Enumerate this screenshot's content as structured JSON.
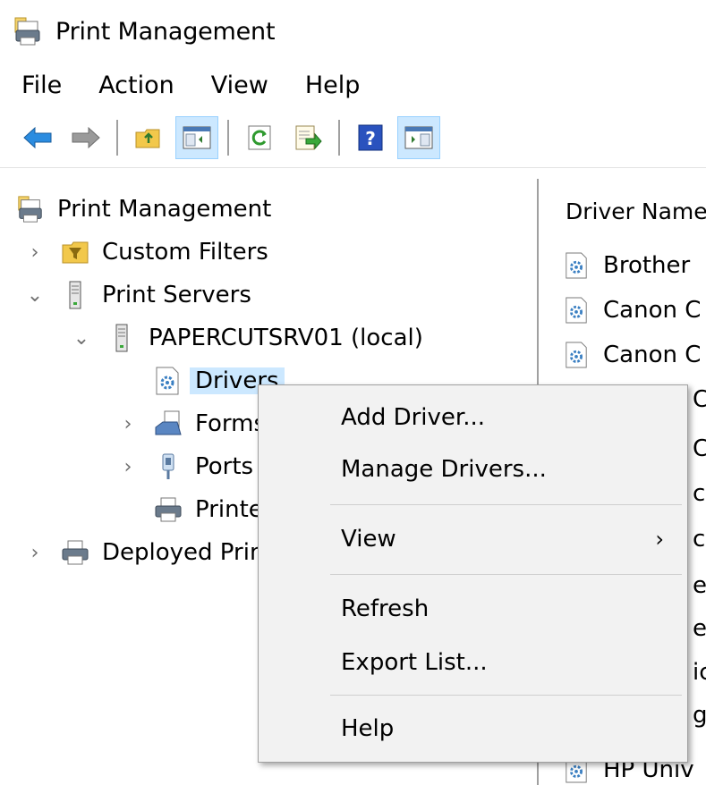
{
  "window": {
    "title": "Print Management"
  },
  "menu": [
    "File",
    "Action",
    "View",
    "Help"
  ],
  "toolbar": {
    "buttons": [
      "back-icon",
      "forward-icon",
      "up-folder-icon",
      "show-hide-console-tree-icon",
      "refresh-icon",
      "export-list-icon",
      "help-icon",
      "show-hide-action-pane-icon"
    ]
  },
  "tree": {
    "root": "Print Management",
    "custom_filters": "Custom Filters",
    "print_servers": "Print Servers",
    "server": "PAPERCUTSRV01 (local)",
    "drivers": "Drivers",
    "forms": "Forms",
    "ports": "Ports",
    "printers": "Printers",
    "deployed": "Deployed Printers"
  },
  "list": {
    "column_header": "Driver Name",
    "rows": [
      "Brother",
      "Canon C",
      "Canon C",
      "C",
      "C",
      "c",
      "c",
      "e",
      "e",
      "ic",
      "ge",
      "HP Univ"
    ]
  },
  "context_menu": {
    "add_driver": "Add Driver...",
    "manage_drivers": "Manage Drivers...",
    "view": "View",
    "refresh": "Refresh",
    "export_list": "Export List...",
    "help": "Help"
  }
}
